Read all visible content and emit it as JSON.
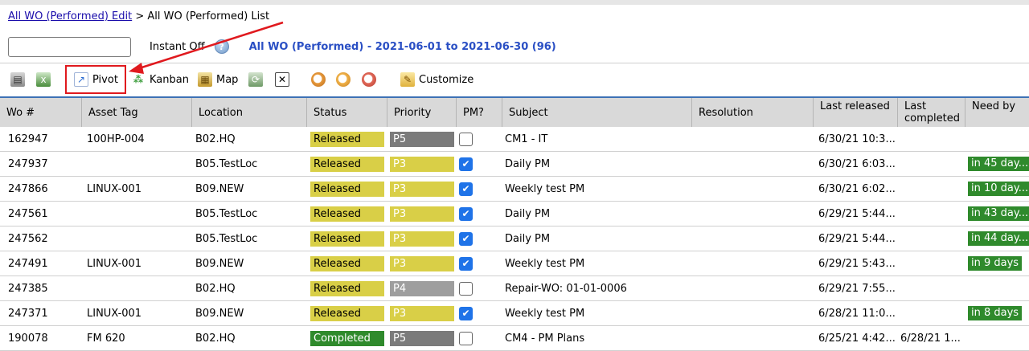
{
  "breadcrumb": {
    "link": "All WO (Performed) Edit",
    "separator": " > ",
    "current": "All WO (Performed) List"
  },
  "search": {
    "value": "",
    "placeholder": ""
  },
  "instant": {
    "label": "Instant Off"
  },
  "report_title": "All WO (Performed) - 2021-06-01 to 2021-06-30 (96)",
  "toolbar": {
    "pivot": "Pivot",
    "kanban": "Kanban",
    "map": "Map",
    "customize": "Customize"
  },
  "colors": {
    "accent": "#2a4fc4",
    "released": "#d9cf47",
    "completed": "#2f8a2c",
    "annotation": "#e0191e"
  },
  "columns": [
    {
      "label": "Wo #"
    },
    {
      "label": "Asset Tag"
    },
    {
      "label": "Location"
    },
    {
      "label": "Status"
    },
    {
      "label": "Priority"
    },
    {
      "label": "PM?"
    },
    {
      "label": "Subject"
    },
    {
      "label": "Resolution"
    },
    {
      "label": "Last released"
    },
    {
      "label": "Last completed"
    },
    {
      "label": "Need by"
    }
  ],
  "rows": [
    {
      "wo": "162947",
      "asset": "100HP-004",
      "location": "B02.HQ",
      "status": "Released",
      "priority": "P5",
      "pm": false,
      "subject": "CM1 - IT",
      "resolution": "",
      "last_released": "6/30/21 10:3...",
      "last_completed": "",
      "need_by": ""
    },
    {
      "wo": "247937",
      "asset": "",
      "location": "B05.TestLoc",
      "status": "Released",
      "priority": "P3",
      "pm": true,
      "subject": "Daily PM",
      "resolution": "",
      "last_released": "6/30/21 6:03...",
      "last_completed": "",
      "need_by": "in 45 day..."
    },
    {
      "wo": "247866",
      "asset": "LINUX-001",
      "location": "B09.NEW",
      "status": "Released",
      "priority": "P3",
      "pm": true,
      "subject": "Weekly test PM",
      "resolution": "",
      "last_released": "6/30/21 6:02...",
      "last_completed": "",
      "need_by": "in 10 day..."
    },
    {
      "wo": "247561",
      "asset": "",
      "location": "B05.TestLoc",
      "status": "Released",
      "priority": "P3",
      "pm": true,
      "subject": "Daily PM",
      "resolution": "",
      "last_released": "6/29/21 5:44...",
      "last_completed": "",
      "need_by": "in 43 day..."
    },
    {
      "wo": "247562",
      "asset": "",
      "location": "B05.TestLoc",
      "status": "Released",
      "priority": "P3",
      "pm": true,
      "subject": "Daily PM",
      "resolution": "",
      "last_released": "6/29/21 5:44...",
      "last_completed": "",
      "need_by": "in 44 day..."
    },
    {
      "wo": "247491",
      "asset": "LINUX-001",
      "location": "B09.NEW",
      "status": "Released",
      "priority": "P3",
      "pm": true,
      "subject": "Weekly test PM",
      "resolution": "",
      "last_released": "6/29/21 5:43...",
      "last_completed": "",
      "need_by": "in 9 days"
    },
    {
      "wo": "247385",
      "asset": "",
      "location": "B02.HQ",
      "status": "Released",
      "priority": "P4",
      "pm": false,
      "subject": "Repair-WO: 01-01-0006",
      "resolution": "",
      "last_released": "6/29/21 7:55...",
      "last_completed": "",
      "need_by": ""
    },
    {
      "wo": "247371",
      "asset": "LINUX-001",
      "location": "B09.NEW",
      "status": "Released",
      "priority": "P3",
      "pm": true,
      "subject": "Weekly test PM",
      "resolution": "",
      "last_released": "6/28/21 11:0...",
      "last_completed": "",
      "need_by": "in 8 days"
    },
    {
      "wo": "190078",
      "asset": "FM 620",
      "location": "B02.HQ",
      "status": "Completed",
      "priority": "P5",
      "pm": false,
      "subject": "CM4 - PM Plans",
      "resolution": "",
      "last_released": "6/25/21 4:42...",
      "last_completed": "6/28/21 1...",
      "need_by": ""
    }
  ]
}
